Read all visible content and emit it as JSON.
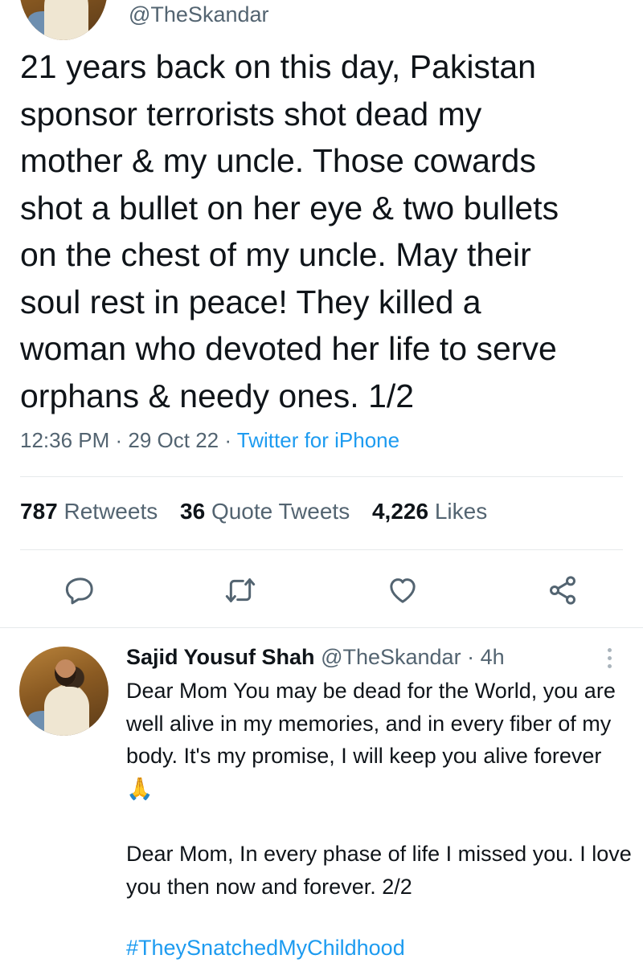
{
  "main_tweet": {
    "handle": "@TheSkandar",
    "text": "21 years back on this day, Pakistan\nsponsor terrorists shot dead my\nmother & my uncle. Those cowards\nshot a bullet on her eye & two bullets\non the chest of my uncle. May their\nsoul rest in peace! They killed a\nwoman who devoted her life to serve\norphans & needy ones. 1/2",
    "time": "12:36 PM",
    "date": "29 Oct 22",
    "source": "Twitter for iPhone",
    "separator": " · "
  },
  "stats": {
    "retweets_count": "787",
    "retweets_label": "Retweets",
    "quotes_count": "36",
    "quotes_label": "Quote Tweets",
    "likes_count": "4,226",
    "likes_label": "Likes"
  },
  "actions": {
    "reply_icon": "reply-icon",
    "retweet_icon": "retweet-icon",
    "like_icon": "heart-icon",
    "share_icon": "share-icon"
  },
  "reply_tweet": {
    "name": "Sajid Yousuf Shah",
    "handle": "@TheSkandar",
    "separator": " · ",
    "time": "4h",
    "paragraph1": "Dear Mom You may be dead for the World, you are well alive in my memories, and in every fiber of my body. It's my promise, I will keep you alive forever 🙏",
    "paragraph2": "Dear Mom, In every phase of life I missed you. I love you then now and forever. 2/2",
    "hashtag": "#TheySnatchedMyChildhood"
  },
  "colors": {
    "link": "#1d9bf0",
    "secondary_text": "#536471",
    "primary_text": "#0f1419"
  }
}
